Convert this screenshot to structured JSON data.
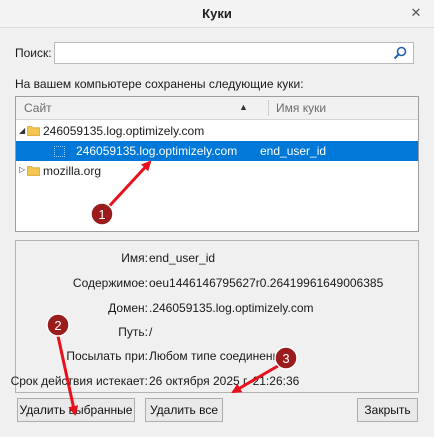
{
  "window": {
    "title": "Куки",
    "close_glyph": "✕"
  },
  "search": {
    "label": "Поиск:",
    "value": "",
    "placeholder": ""
  },
  "info_text": "На вашем компьютере сохранены следующие куки:",
  "tree": {
    "columns": {
      "site": "Сайт",
      "name": "Имя куки"
    },
    "rows": [
      {
        "site": "246059135.log.optimizely.com",
        "name": "",
        "expanded": true
      },
      {
        "site": "246059135.log.optimizely.com",
        "name": "end_user_id",
        "selected": true
      },
      {
        "site": "mozilla.org",
        "name": "",
        "expanded": false
      }
    ]
  },
  "details": {
    "name_label": "Имя:",
    "name_value": "end_user_id",
    "content_label": "Содержимое:",
    "content_value": "oeu1446146795627r0.26419961649006385",
    "domain_label": "Домен:",
    "domain_value": ".246059135.log.optimizely.com",
    "path_label": "Путь:",
    "path_value": "/",
    "send_label": "Посылать при:",
    "send_value": "Любом типе соединения",
    "expires_label": "Срок действия истекает:",
    "expires_value": "26 октября 2025 г. 21:26:36"
  },
  "buttons": {
    "remove_selected": "Удалить выбранные",
    "remove_all": "Удалить все",
    "close": "Закрыть"
  },
  "annotations": [
    "1",
    "2",
    "3"
  ],
  "colors": {
    "selection": "#0078d7",
    "annotation": "#e8101a",
    "badge": "#9b1c1c"
  }
}
